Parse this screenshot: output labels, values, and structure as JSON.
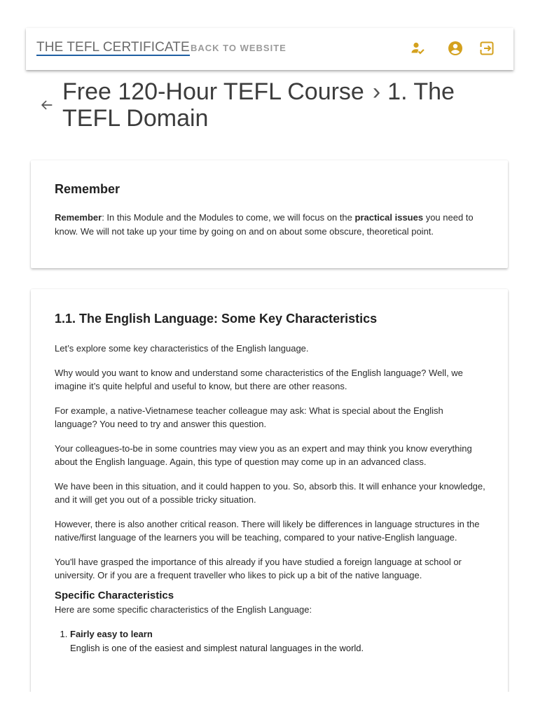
{
  "header": {
    "brand": "THE TEFL CERTIFICATE",
    "back_link": "BACK TO WEBSITE",
    "icons": [
      "person-check-icon",
      "account-circle-icon",
      "logout-icon"
    ],
    "accent_color": "#d4a11e"
  },
  "title": {
    "course": "Free 120-Hour TEFL Course",
    "separator": "›",
    "module": "1. The TEFL Domain"
  },
  "remember_card": {
    "heading": "Remember",
    "label": "Remember",
    "text_before": ": In this Module and the Modules to come, we will focus on the ",
    "bold_phrase": "practical issues",
    "text_after": " you need to know. We will not take up your time by going on and on about some obscure, theoretical point."
  },
  "section": {
    "heading": "1.1. The English Language: Some Key Characteristics",
    "paragraphs": [
      "Let’s explore some key characteristics of the English language.",
      "Why would you want to know and understand some characteristics of the English language? Well, we imagine it’s quite helpful and useful to know, but there are other reasons.",
      "For example, a native-Vietnamese teacher colleague may ask: What is special about the English language? You need to try and answer this question.",
      "Your colleagues-to-be in some countries may view you as an expert and may think you know everything about the English language. Again, this type of question may come up in an advanced class.",
      "We have been in this situation, and it could happen to you. So, absorb this. It will enhance your knowledge, and it will get you out of a possible tricky situation.",
      "However, there is also another critical reason. There will likely be differences in language structures in the native/first language of the learners you will be teaching, compared to your native-English language.",
      "You'll have grasped the importance of this already if you have studied a foreign language at school or university. Or if you are a frequent traveller who likes to pick up a bit of the native language."
    ],
    "subheading": "Specific Characteristics",
    "intro": "Here are some specific characteristics of the English Language:",
    "list": [
      {
        "title": "Fairly easy to learn",
        "text": "English is one of the easiest and simplest natural languages in the world."
      }
    ]
  }
}
